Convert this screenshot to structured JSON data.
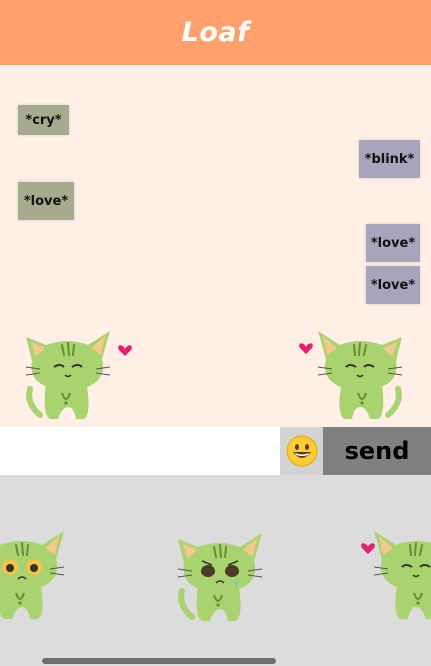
{
  "header": {
    "title": "Loaf"
  },
  "chat": {
    "messages": [
      {
        "side": "left",
        "text": "*cry*"
      },
      {
        "side": "right",
        "text": "*blink*"
      },
      {
        "side": "left",
        "text": "*love*"
      },
      {
        "side": "right",
        "text": "*love*"
      },
      {
        "side": "right",
        "text": "*love*"
      }
    ],
    "avatars": {
      "left": "cat-love-icon",
      "right": "cat-love-icon"
    }
  },
  "composer": {
    "input_value": "",
    "input_placeholder": "",
    "emoji_icon": "grinning-face-icon",
    "emoji_glyph": "😀",
    "send_label": "send"
  },
  "stickers": [
    {
      "name": "cat-shocked-sticker"
    },
    {
      "name": "cat-crying-sticker"
    },
    {
      "name": "cat-love-sticker"
    }
  ],
  "colors": {
    "header": "#FFA06D",
    "chat_bg": "#FFEFE6",
    "left_bubble": "#A6AA8E",
    "right_bubble": "#A8A4BB",
    "send_button": "#808080",
    "emoji_button": "#D3D3D3",
    "tray": "#DCDCDC",
    "cat_fill": "#A9D36F",
    "heart": "#EE1C6C"
  }
}
